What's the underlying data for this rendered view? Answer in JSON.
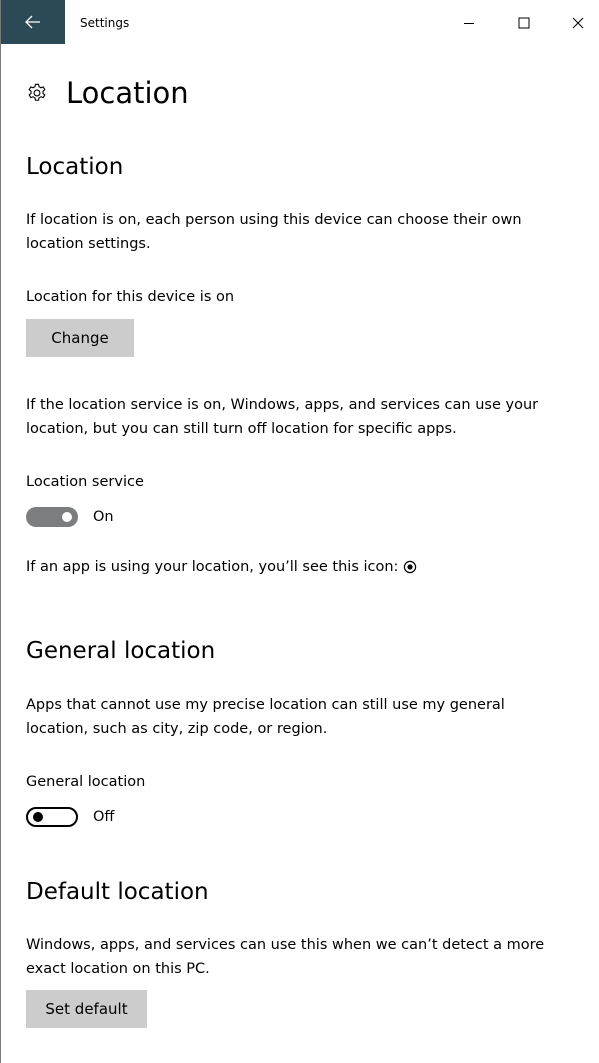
{
  "window": {
    "title": "Settings"
  },
  "header": {
    "title": "Location",
    "icon": "gear-icon"
  },
  "location_section": {
    "title": "Location",
    "description": "If location is on, each person using this device can choose their own location settings.",
    "status": "Location for this device is on",
    "change_button": "Change",
    "service_description": "If the location service is on, Windows, apps, and services can use your location, but you can still turn off location for specific apps.",
    "service_label": "Location service",
    "service_toggle_state": "On",
    "icon_hint": "If an app is using your location, you’ll see this icon:"
  },
  "general_section": {
    "title": "General location",
    "description": "Apps that cannot use my precise location can still use my general location, such as city, zip code, or region.",
    "toggle_label": "General location",
    "toggle_state": "Off"
  },
  "default_section": {
    "title": "Default location",
    "description": "Windows, apps, and services can use this when we can’t detect a more exact location on this PC.",
    "set_default_button": "Set default"
  },
  "colors": {
    "titlebar_accent": "#2b4a55",
    "button_bg": "#cccccc",
    "toggle_on_bg": "#7b7d7e"
  }
}
